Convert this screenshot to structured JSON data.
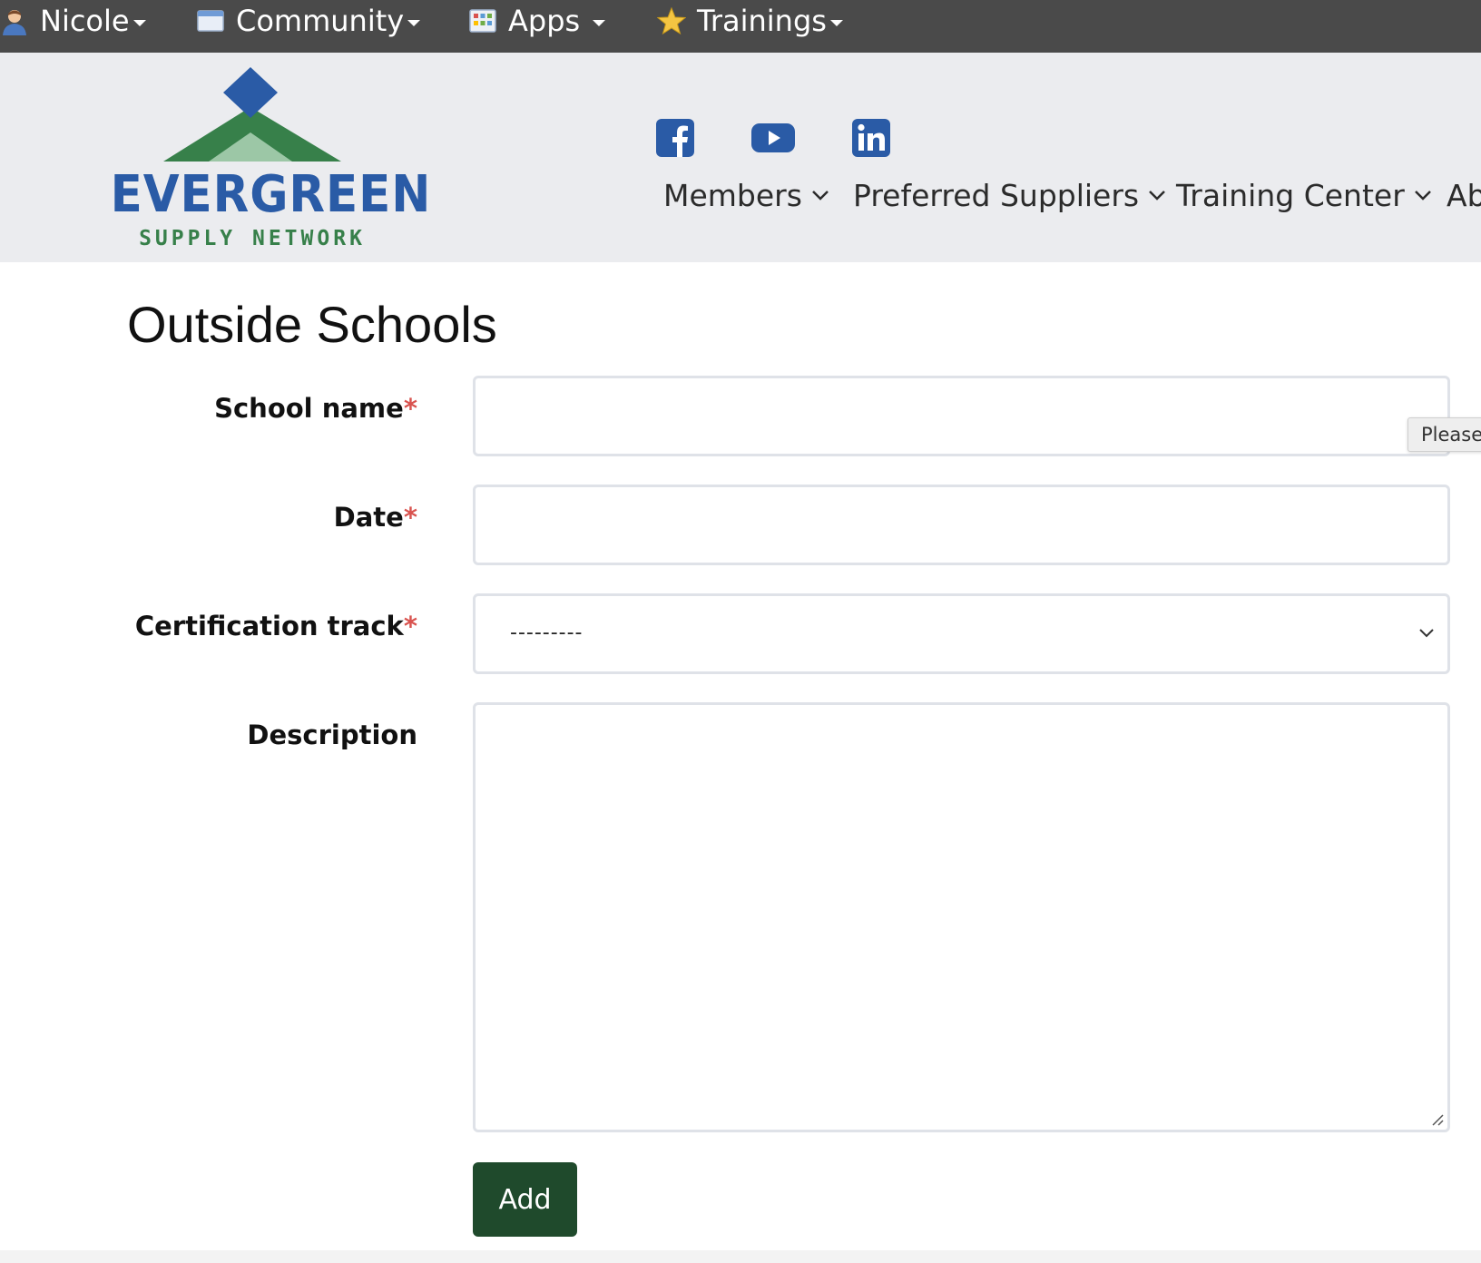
{
  "topbar": {
    "items": [
      {
        "label": "Nicole",
        "icon": "user-icon"
      },
      {
        "label": "Community",
        "icon": "window-icon"
      },
      {
        "label": "Apps",
        "icon": "apps-grid-icon"
      },
      {
        "label": "Trainings",
        "icon": "star-icon"
      }
    ]
  },
  "header": {
    "logo_word": "EVERGREEN",
    "logo_sub": "SUPPLY NETWORK",
    "social": [
      "facebook-icon",
      "youtube-icon",
      "linkedin-icon"
    ],
    "nav": [
      {
        "label": "Members"
      },
      {
        "label": "Preferred Suppliers"
      },
      {
        "label": "Training Center"
      },
      {
        "label": "Ab"
      }
    ]
  },
  "main": {
    "title": "Outside Schools",
    "fields": {
      "school_name": {
        "label": "School name",
        "required": "*",
        "value": "",
        "placeholder": ""
      },
      "date": {
        "label": "Date",
        "required": "*",
        "value": "",
        "placeholder": ""
      },
      "certification_track": {
        "label": "Certification track",
        "required": "*",
        "selected": "---------"
      },
      "description": {
        "label": "Description",
        "value": ""
      }
    },
    "tooltip": "Please",
    "add_button": "Add"
  },
  "colors": {
    "topbar": "#4a4a4a",
    "header_bg": "#ebecef",
    "brand_blue": "#2a5ba6",
    "brand_green": "#37804a",
    "button_green": "#1f4a2c",
    "required": "#d9534f"
  }
}
